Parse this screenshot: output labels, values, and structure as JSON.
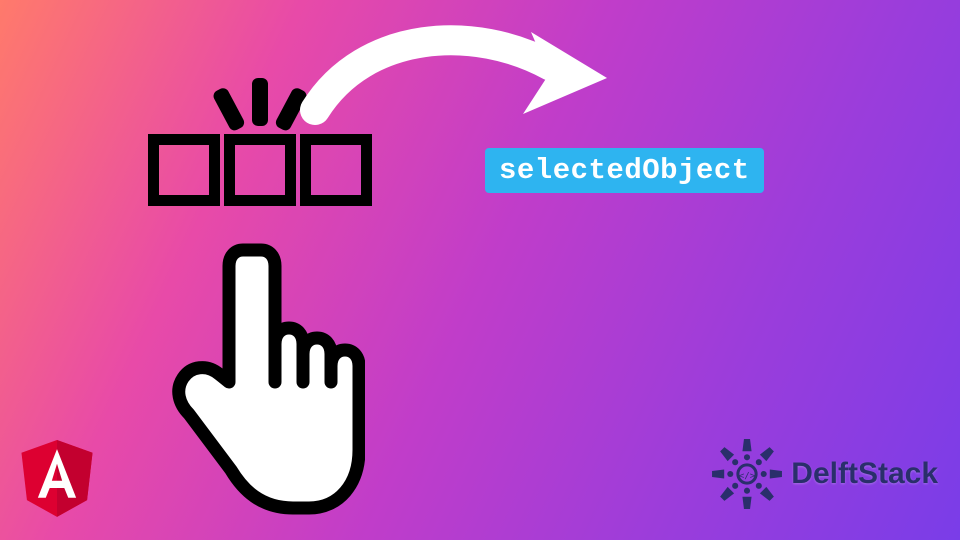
{
  "code_label": "selectedObject",
  "brand": {
    "delftstack_text": "DelftStack"
  },
  "icons": {
    "hand": "hand-pointer-icon",
    "arrow": "curved-arrow-icon",
    "boxes": "three-boxes-icon",
    "burst": "selection-burst-icon",
    "angular": "angular-logo-icon",
    "delftstack_badge": "delftstack-badge-icon"
  },
  "colors": {
    "label_bg": "#2eb4f0",
    "label_fg": "#ffffff",
    "angular_red": "#dd0031",
    "brand_blue": "#2a2f6b"
  }
}
